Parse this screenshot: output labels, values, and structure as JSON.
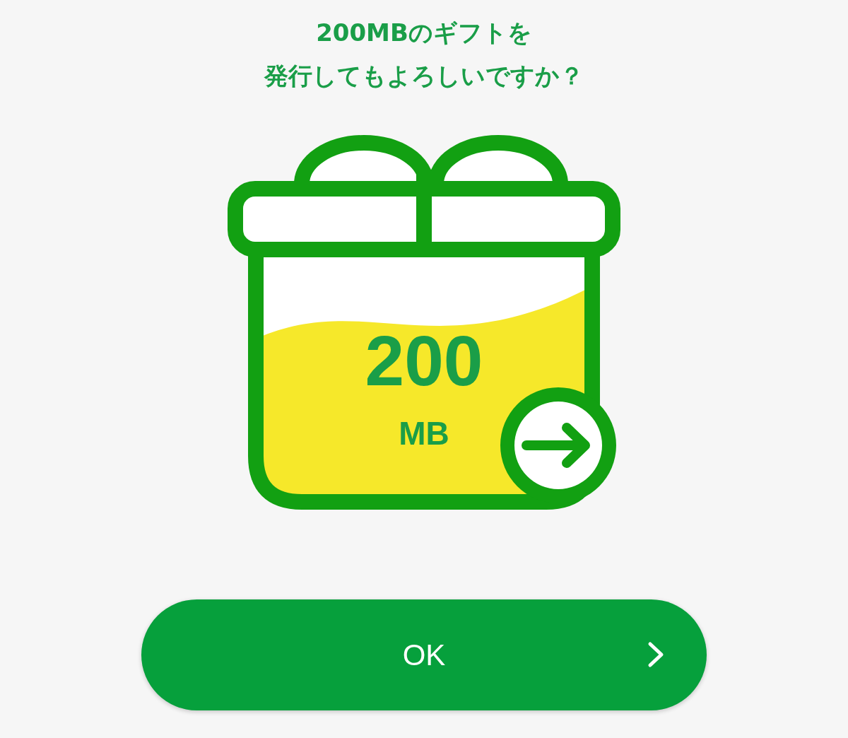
{
  "title_lines": [
    "200MBのギフトを",
    "発行してもよろしいですか？"
  ],
  "gift": {
    "amount": "200",
    "unit": "MB"
  },
  "button": {
    "label": "OK"
  }
}
